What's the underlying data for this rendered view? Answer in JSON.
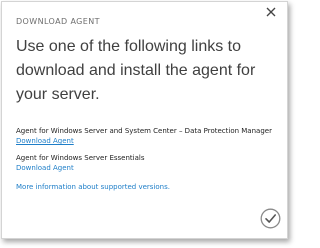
{
  "dialog": {
    "header": "DOWNLOAD AGENT",
    "headline": "Use one of the following links to download and install the agent for your server.",
    "sections": [
      {
        "label": "Agent for Windows Server and System Center – Data Protection Manager",
        "link": "Download Agent"
      },
      {
        "label": "Agent for Windows Server Essentials",
        "link": "Download Agent"
      }
    ],
    "more_info_link": "More information about supported versions."
  },
  "icons": {
    "close": "close-icon",
    "ok": "checkmark-icon"
  },
  "colors": {
    "link": "#1e7ec8",
    "headline": "#404040",
    "header": "#6e6e6e"
  }
}
